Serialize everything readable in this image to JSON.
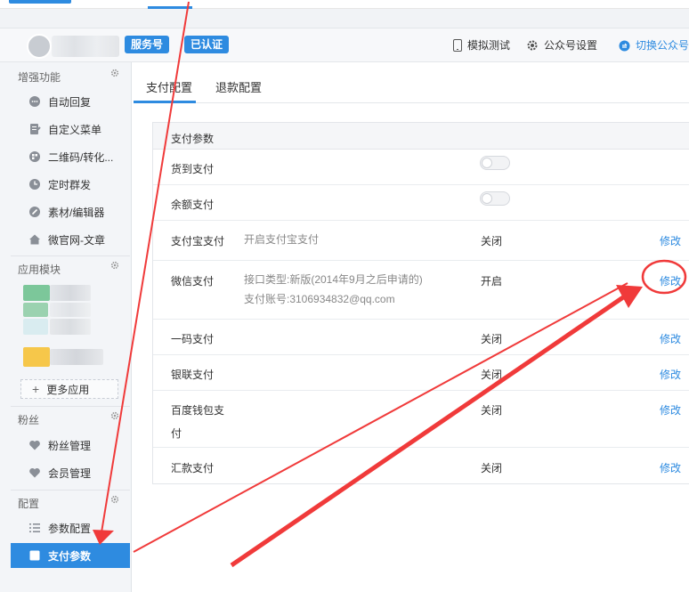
{
  "header": {
    "service_badge": "服务号",
    "verified_badge": "已认证",
    "simulate_test": "模拟测试",
    "account_settings": "公众号设置",
    "switch_account": "切换公众号"
  },
  "sidebar": {
    "sections": [
      {
        "title": "增强功能",
        "items": [
          "自动回复",
          "自定义菜单",
          "二维码/转化...",
          "定时群发",
          "素材/编辑器",
          "微官网-文章"
        ]
      },
      {
        "title": "应用模块",
        "more": "更多应用"
      },
      {
        "title": "粉丝",
        "items": [
          "粉丝管理",
          "会员管理"
        ]
      },
      {
        "title": "配置",
        "items": [
          "参数配置",
          "支付参数"
        ]
      }
    ],
    "active_item": "支付参数"
  },
  "tabs": {
    "pay_config": "支付配置",
    "refund_config": "退款配置"
  },
  "panel": {
    "title": "支付参数",
    "edit_label": "修改",
    "rows": [
      {
        "name": "货到支付",
        "toggle": false
      },
      {
        "name": "余额支付",
        "toggle": false
      },
      {
        "name": "支付宝支付",
        "desc": "开启支付宝支付",
        "status": "关闭"
      },
      {
        "name": "微信支付",
        "desc_line1": "接口类型:新版(2014年9月之后申请的)",
        "desc_line2": "支付账号:3106934832@qq.com",
        "status": "开启"
      },
      {
        "name": "一码支付",
        "status": "关闭"
      },
      {
        "name": "银联支付",
        "status": "关闭"
      },
      {
        "name_line1": "百度钱包支",
        "name_line2": "付",
        "status": "关闭"
      },
      {
        "name": "汇款支付",
        "status": "关闭"
      }
    ]
  },
  "colors": {
    "accent": "#2e8be0",
    "annotation": "#f03a3a"
  }
}
